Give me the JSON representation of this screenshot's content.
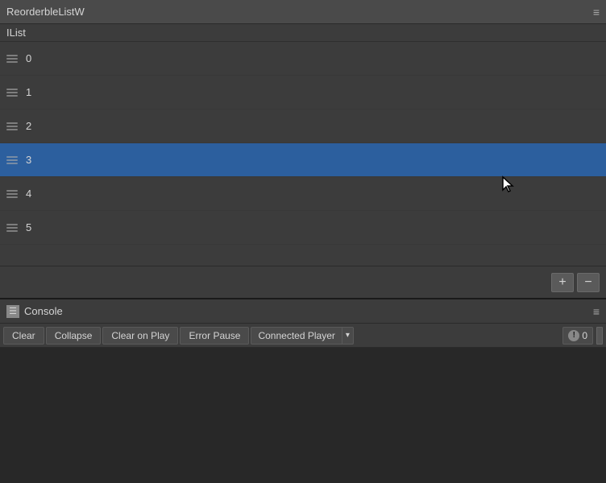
{
  "topPanel": {
    "title": "ReorderbleListW",
    "menuIcon": "≡",
    "listHeader": "IList",
    "items": [
      {
        "index": 0,
        "label": "0",
        "selected": false
      },
      {
        "index": 1,
        "label": "1",
        "selected": false
      },
      {
        "index": 2,
        "label": "2",
        "selected": false
      },
      {
        "index": 3,
        "label": "3",
        "selected": true
      },
      {
        "index": 4,
        "label": "4",
        "selected": false
      },
      {
        "index": 5,
        "label": "5",
        "selected": false
      }
    ],
    "addButton": "+",
    "removeButton": "−"
  },
  "bottomPanel": {
    "title": "Console",
    "consoleIcon": "☰",
    "menuIcon": "≡",
    "toolbar": {
      "clearLabel": "Clear",
      "collapseLabel": "Collapse",
      "clearOnPlayLabel": "Clear on Play",
      "errorPauseLabel": "Error Pause",
      "connectedPlayerLabel": "Connected Player",
      "warningCount": "0"
    }
  }
}
